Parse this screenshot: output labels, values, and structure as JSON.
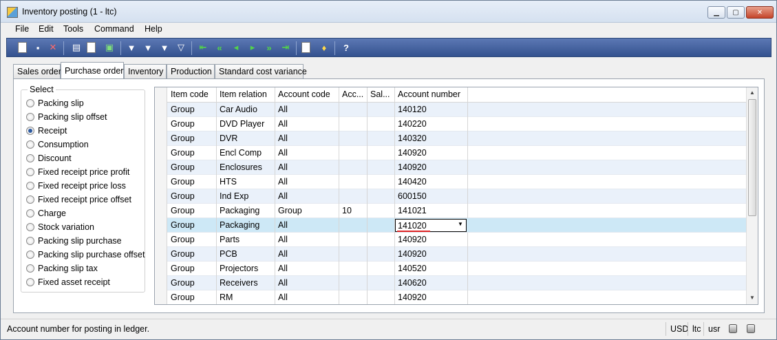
{
  "window": {
    "title": "Inventory posting (1 - ltc)",
    "buttons": [
      "▁",
      "▢",
      "✕"
    ]
  },
  "menu": [
    "File",
    "Edit",
    "Tools",
    "Command",
    "Help"
  ],
  "toolbar": {
    "icons": [
      "new-icon",
      "save-icon",
      "delete-icon",
      "print-icon",
      "print-preview-icon",
      "export-excel-icon",
      "filter-by-selection-icon",
      "filter-by-grid-icon",
      "advanced-filter-icon",
      "remove-filter-icon",
      "first-record-icon",
      "previous-page-icon",
      "previous-record-icon",
      "next-record-icon",
      "next-page-icon",
      "last-record-icon",
      "attachments-icon",
      "alert-icon",
      "help-icon"
    ]
  },
  "tabs": [
    "Sales order",
    "Purchase order",
    "Inventory",
    "Production",
    "Standard cost variance"
  ],
  "active_tab": "Purchase order",
  "select": {
    "label": "Select",
    "options": [
      "Packing slip",
      "Packing slip offset",
      "Receipt",
      "Consumption",
      "Discount",
      "Fixed receipt price profit",
      "Fixed receipt price loss",
      "Fixed receipt price offset",
      "Charge",
      "Stock variation",
      "Packing slip purchase",
      "Packing slip purchase offset",
      "Packing slip tax",
      "Fixed asset receipt"
    ],
    "selected": "Receipt"
  },
  "grid": {
    "columns": [
      "Item code",
      "Item relation",
      "Account code",
      "Acc...",
      "Sal...",
      "Account number"
    ],
    "rows": [
      [
        "Group",
        "Car Audio",
        "All",
        "",
        "",
        "140120"
      ],
      [
        "Group",
        "DVD Player",
        "All",
        "",
        "",
        "140220"
      ],
      [
        "Group",
        "DVR",
        "All",
        "",
        "",
        "140320"
      ],
      [
        "Group",
        "Encl Comp",
        "All",
        "",
        "",
        "140920"
      ],
      [
        "Group",
        "Enclosures",
        "All",
        "",
        "",
        "140920"
      ],
      [
        "Group",
        "HTS",
        "All",
        "",
        "",
        "140420"
      ],
      [
        "Group",
        "Ind Exp",
        "All",
        "",
        "",
        "600150"
      ],
      [
        "Group",
        "Packaging",
        "Group",
        "10",
        "",
        "141021"
      ],
      [
        "Group",
        "Packaging",
        "All",
        "",
        "",
        "141020"
      ],
      [
        "Group",
        "Parts",
        "All",
        "",
        "",
        "140920"
      ],
      [
        "Group",
        "PCB",
        "All",
        "",
        "",
        "140920"
      ],
      [
        "Group",
        "Projectors",
        "All",
        "",
        "",
        "140520"
      ],
      [
        "Group",
        "Receivers",
        "All",
        "",
        "",
        "140620"
      ],
      [
        "Group",
        "RM",
        "All",
        "",
        "",
        "140920"
      ]
    ],
    "selected_row": 8
  },
  "status": {
    "text": "Account number for posting in ledger.",
    "currency": "USD",
    "company": "ltc",
    "layer": "usr"
  }
}
